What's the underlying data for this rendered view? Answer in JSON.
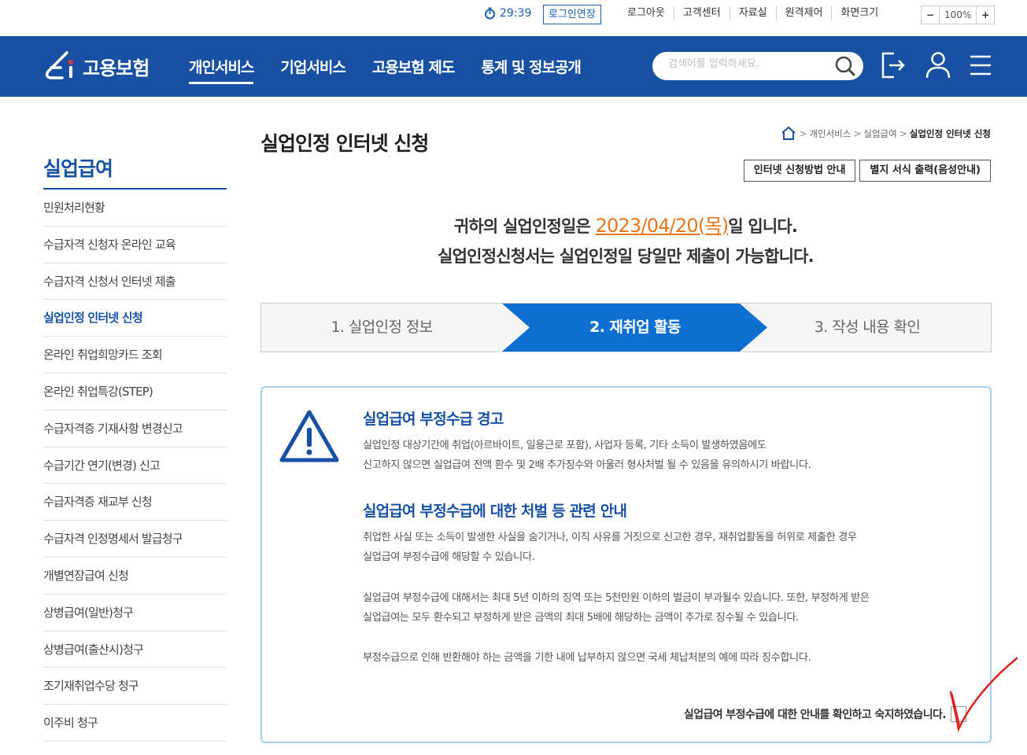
{
  "utility": {
    "timer": "29:39",
    "extend_label": "로그인연장",
    "links": [
      "로그아웃",
      "고객센터",
      "자료실",
      "원격제어",
      "화면크기"
    ],
    "zoom_minus": "−",
    "zoom_value": "100%",
    "zoom_plus": "+"
  },
  "header": {
    "logo_text": "고용보험",
    "menu": [
      "개인서비스",
      "기업서비스",
      "고용보험 제도",
      "통계 및 정보공개"
    ],
    "search_placeholder": "검색어를 입력하세요."
  },
  "sidebar": {
    "title": "실업급여",
    "items": [
      {
        "label": "민원처리현황"
      },
      {
        "label": "수급자격 신청자 온라인 교육"
      },
      {
        "label": "수급자격 신청서 인터넷 제출"
      },
      {
        "label": "실업인정 인터넷 신청",
        "active": true
      },
      {
        "label": "온라인 취업희망카드 조회"
      },
      {
        "label": "온라인 취업특강(STEP)"
      },
      {
        "label": "수급자격증 기재사항 변경신고"
      },
      {
        "label": "수급기간 연기(변경) 신고"
      },
      {
        "label": "수급자격증 재교부 신청"
      },
      {
        "label": "수급자격 인정명세서 발급청구"
      },
      {
        "label": "개별연장급여 신청"
      },
      {
        "label": "상병급여(일반)청구"
      },
      {
        "label": "상병급여(출산시)청구"
      },
      {
        "label": "조기재취업수당 청구"
      },
      {
        "label": "이주비 청구"
      }
    ]
  },
  "content": {
    "title": "실업인정 인터넷 신청",
    "breadcrumb": [
      "개인서비스",
      "실업급여",
      "실업인정 인터넷 신청"
    ],
    "buttons": [
      "인터넷 신청방법 안내",
      "별지 서식 출력(음성안내)"
    ],
    "notice_prefix": "귀하의 실업인정일은 ",
    "notice_date": "2023/04/20(목)",
    "notice_suffix": "일 입니다.",
    "notice_line2": "실업인정신청서는 실업인정일 당일만 제출이 가능합니다.",
    "steps": [
      "1. 실업인정 정보",
      "2. 재취업 활동",
      "3. 작성 내용 확인"
    ],
    "active_step": 2
  },
  "warning": {
    "title1": "실업급여 부정수급 경고",
    "text1_line1": "실업인정 대상기간에 취업(아르바이트, 일용근로 포함), 사업자 등록, 기타 소득이 발생하였음에도",
    "text1_line2": "신고하지 않으면 실업급여 전액 환수 및 2배 추가징수와 아울러 형사처벌 될 수 있음을 유의하시기 바랍니다.",
    "title2": "실업급여 부정수급에 대한 처벌 등 관련 안내",
    "text2_line1": "취업한 사실 또는 소득이 발생한 사실을 숨기거나, 이직 사유를 거짓으로 신고한 경우, 재취업활동을 허위로 제출한 경우",
    "text2_line2": "실업급여 부정수급에 해당할 수 있습니다.",
    "text3_line1": "실업급여 부정수급에 대해서는 최대 5년 이하의 징역 또는 5천만원 이하의 벌금이 부과될수 있습니다. 또한, 부정하게 받은",
    "text3_line2": "실업급여는 모두 환수되고 부정하게 받은 금액의 최대 5배에 해당하는 금액이 추가로 징수될 수 있습니다.",
    "text4": "부정수급으로 인해 반환해야 하는 금액을 기한 내에 납부하지 않으면 국세 체납처분의 예에 따라 징수합니다.",
    "agree_label": "실업급여 부정수급에 대한 안내를 확인하고 숙지하였습니다.",
    "agree_checked": false
  },
  "colors": {
    "brand": "#1850a3",
    "step_active": "#0f6fd1",
    "date_accent": "#e8761e",
    "annotation_check": "#e02020"
  }
}
